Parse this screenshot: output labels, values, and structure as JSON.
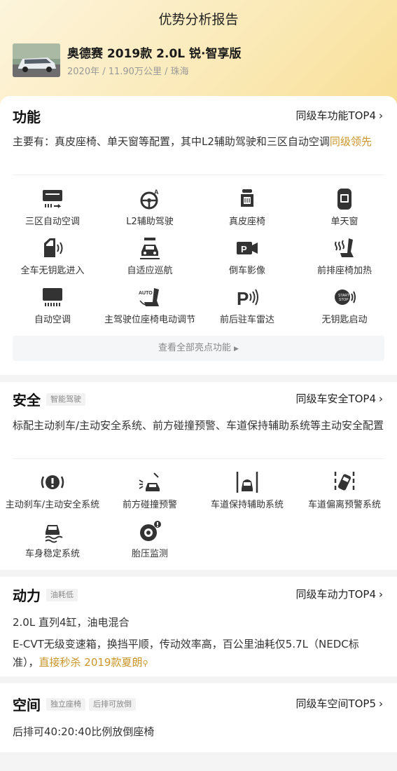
{
  "page_title": "优势分析报告",
  "car": {
    "name": "奥德赛 2019款 2.0L 锐·智享版",
    "meta": "2020年 / 11.90万公里 / 珠海"
  },
  "function_section": {
    "title": "功能",
    "top_link": "同级车功能TOP4",
    "desc_prefix": "主要有：真皮座椅、单天窗等配置，其中L2辅助驾驶和三区自动空调",
    "desc_highlight": "同级领先",
    "features": [
      {
        "icon": "ac-icon",
        "label": "三区自动空调"
      },
      {
        "icon": "steering-assist-icon",
        "label": "L2辅助驾驶"
      },
      {
        "icon": "leather-seat-icon",
        "label": "真皮座椅"
      },
      {
        "icon": "sunroof-icon",
        "label": "单天窗"
      },
      {
        "icon": "keyless-entry-icon",
        "label": "全车无钥匙进入"
      },
      {
        "icon": "adaptive-cruise-icon",
        "label": "自适应巡航"
      },
      {
        "icon": "reverse-camera-icon",
        "label": "倒车影像"
      },
      {
        "icon": "seat-heating-icon",
        "label": "前排座椅加热"
      },
      {
        "icon": "auto-ac-icon",
        "label": "自动空调"
      },
      {
        "icon": "power-seat-icon",
        "label": "主驾驶位座椅电动调节"
      },
      {
        "icon": "parking-radar-icon",
        "label": "前后驻车雷达"
      },
      {
        "icon": "keyless-start-icon",
        "label": "无钥匙启动"
      }
    ],
    "more_label": "查看全部亮点功能"
  },
  "safety_section": {
    "title": "安全",
    "tag": "智能驾驶",
    "top_link": "同级车安全TOP4",
    "desc": "标配主动刹车/主动安全系统、前方碰撞预警、车道保持辅助系统等主动安全配置",
    "features": [
      {
        "icon": "active-brake-icon",
        "label": "主动刹车/主动安全系统"
      },
      {
        "icon": "collision-warning-icon",
        "label": "前方碰撞预警"
      },
      {
        "icon": "lane-keep-icon",
        "label": "车道保持辅助系统"
      },
      {
        "icon": "lane-departure-icon",
        "label": "车道偏离预警系统"
      },
      {
        "icon": "stability-icon",
        "label": "车身稳定系统"
      },
      {
        "icon": "tire-pressure-icon",
        "label": "胎压监测"
      }
    ]
  },
  "power_section": {
    "title": "动力",
    "tag": "油耗低",
    "top_link": "同级车动力TOP4",
    "line1": "2.0L 直列4缸，油电混合",
    "line2_prefix": "E-CVT无级变速箱，换挡平顺，传动效率高，百公里油耗仅5.7L（NEDC标准），",
    "line2_highlight": "直接秒杀 2019款夏朗",
    "highlight_icon": "search-icon"
  },
  "space_section": {
    "title": "空间",
    "tags": [
      "独立座椅",
      "后排可放倒"
    ],
    "top_link": "同级车空间TOP5",
    "desc": "后排可40:20:40比例放倒座椅"
  },
  "colors": {
    "accent": "#c9962a",
    "hero_gradient_start": "#fcf4dc",
    "hero_gradient_end": "#f8de95"
  }
}
